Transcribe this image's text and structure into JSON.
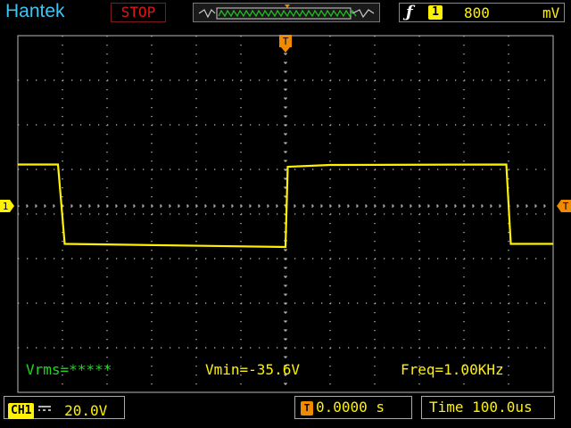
{
  "header": {
    "brand": "Hantek",
    "run_state": "STOP",
    "trigger": {
      "edge_icon": "rising-edge",
      "source": "1",
      "level": "800",
      "unit": "mV"
    }
  },
  "markers": {
    "trigger_position": "T",
    "channel_ground": "1"
  },
  "measurements": {
    "vrms": "Vrms=*****",
    "vmin": "Vmin=-35.6V",
    "freq": "Freq=1.00KHz"
  },
  "footer": {
    "channel": "CH1",
    "coupling_icon": "dc-coupling",
    "volts_div": "20.0V",
    "trigger_tag": "T",
    "time_offset": "0.0000 s",
    "timebase": "Time 100.0us"
  },
  "colors": {
    "trace": "#fff200",
    "grid": "#bdbdbd",
    "trigger_marker": "#f08a00",
    "brand": "#3fc3f4",
    "stop": "#e01818",
    "measure_green": "#20d820"
  },
  "chart_data": {
    "type": "line",
    "title": "",
    "xlabel": "",
    "ylabel": "",
    "x_unit": "div",
    "y_unit": "div",
    "xlim": [
      -6,
      6
    ],
    "ylim": [
      -4,
      4
    ],
    "grid": true,
    "series": [
      {
        "x": [
          -6,
          -5.1,
          -4.95,
          0,
          0.05,
          1,
          4.95,
          5.05,
          6
        ],
        "y": [
          0.93,
          0.93,
          -0.85,
          -0.92,
          0.88,
          0.92,
          0.93,
          -0.85,
          -0.85
        ]
      }
    ]
  }
}
